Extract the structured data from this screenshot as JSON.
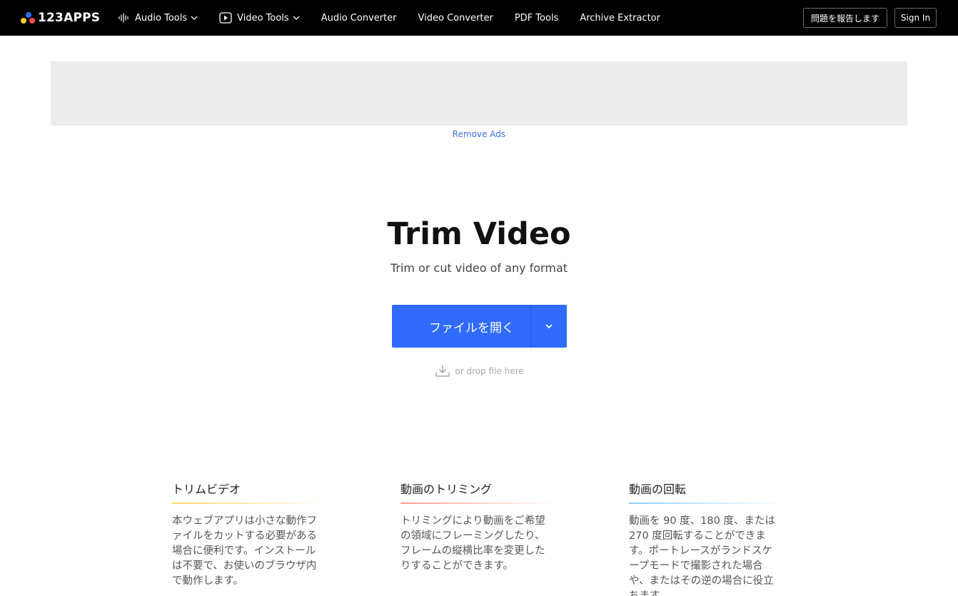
{
  "header": {
    "logo_text": "123APPS",
    "logo_colors": [
      "#ffc91f",
      "#2f6bff",
      "#ff4a4a"
    ],
    "nav": [
      {
        "label": "Audio Tools",
        "icon": "audio-wave-icon",
        "dropdown": true
      },
      {
        "label": "Video Tools",
        "icon": "play-icon",
        "dropdown": true
      },
      {
        "label": "Audio Converter"
      },
      {
        "label": "Video Converter"
      },
      {
        "label": "PDF Tools"
      },
      {
        "label": "Archive Extractor"
      }
    ],
    "report_label": "問題を報告します",
    "signin_label": "Sign In"
  },
  "ad": {
    "remove_ads_label": "Remove Ads"
  },
  "hero": {
    "title": "Trim Video",
    "subtitle": "Trim or cut video of any format",
    "open_file_label": "ファイルを開く",
    "drop_label": "or drop file here",
    "accent": "#2f6bff"
  },
  "features": [
    {
      "title": "トリムビデオ",
      "text": "本ウェブアプリは小さな動作ファイルをカットする必要がある場合に便利です。インストールは不要で、お使いのブラウザ内で動作します。",
      "color": "#ffd86b"
    },
    {
      "title": "動画のトリミング",
      "text": "トリミングにより動画をご希望の領域にフレーミングしたり、フレームの縦横比率を変更したりすることができます。",
      "color": "#ff9b8f"
    },
    {
      "title": "動画の回転",
      "text": "動画を 90 度、180 度、または 270 度回転することができます。ポートレースがランドスケープモードで撮影された場合や、またはその逆の場合に役立ちます。",
      "color": "#8fd0ff"
    }
  ]
}
